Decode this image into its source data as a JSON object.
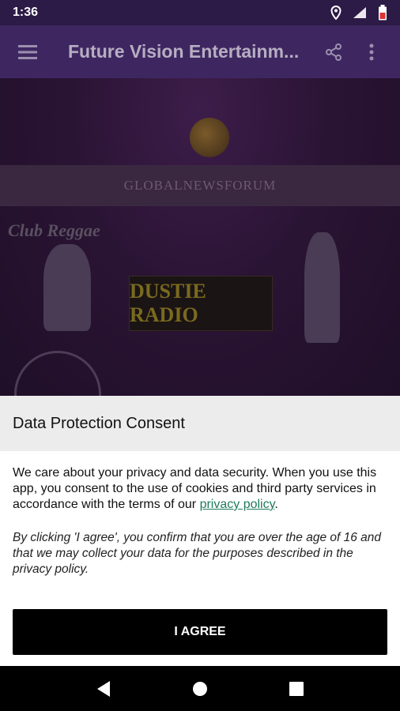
{
  "status_bar": {
    "time": "1:36"
  },
  "app_bar": {
    "title": "Future Vision Entertainm..."
  },
  "background": {
    "banner_text": "GLOBALNEWSFORUM",
    "radio_text": "DUSTIE RADIO",
    "logo_text": "Club Reggae"
  },
  "consent": {
    "title": "Data Protection Consent",
    "body_text": "We care about your privacy and data security. When you use this app, you consent to the use of cookies and third party services in accordance with the terms of our ",
    "privacy_link": "privacy policy",
    "body_end": ".",
    "confirm_text": "By clicking 'I agree', you confirm that you are over the age of 16 and that we may collect your data for the purposes described in the privacy policy.",
    "agree_label": "I AGREE"
  },
  "colors": {
    "app_bar": "#3e2761",
    "link": "#1e7a5a",
    "button": "#000000"
  }
}
